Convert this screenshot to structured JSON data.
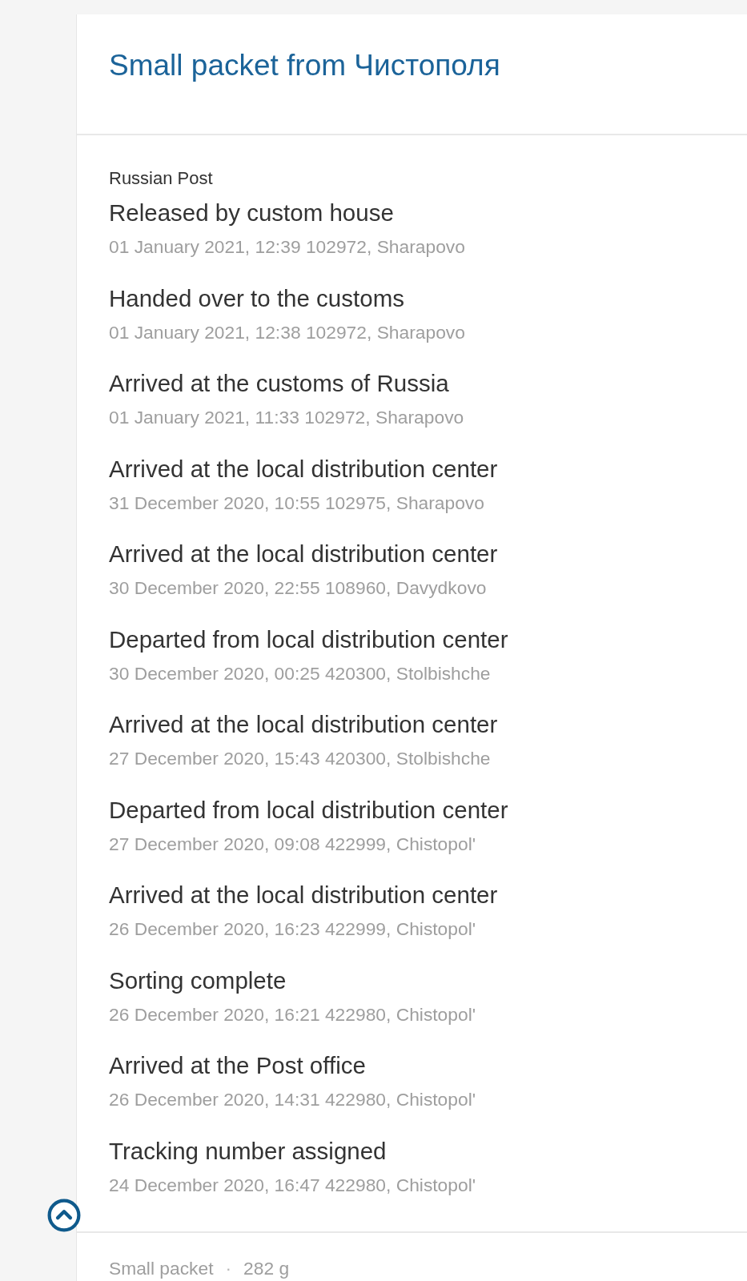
{
  "header": {
    "title": "Small packet from Чистополя"
  },
  "tracking": {
    "carrier": "Russian Post",
    "events": [
      {
        "status": "Released by custom house",
        "details": "01 January 2021, 12:39 102972, Sharapovo"
      },
      {
        "status": "Handed over to the customs",
        "details": "01 January 2021, 12:38 102972, Sharapovo"
      },
      {
        "status": "Arrived at the customs of Russia",
        "details": "01 January 2021, 11:33 102972, Sharapovo"
      },
      {
        "status": "Arrived at the local distribution center",
        "details": "31 December 2020, 10:55 102975, Sharapovo"
      },
      {
        "status": "Arrived at the local distribution center",
        "details": "30 December 2020, 22:55 108960, Davydkovo"
      },
      {
        "status": "Departed from local distribution center",
        "details": "30 December 2020, 00:25 420300, Stolbishche"
      },
      {
        "status": "Arrived at the local distribution center",
        "details": "27 December 2020, 15:43 420300, Stolbishche"
      },
      {
        "status": "Departed from local distribution center",
        "details": "27 December 2020, 09:08 422999, Chistopol'"
      },
      {
        "status": "Arrived at the local distribution center",
        "details": "26 December 2020, 16:23 422999, Chistopol'"
      },
      {
        "status": "Sorting complete",
        "details": "26 December 2020, 16:21 422980, Chistopol'"
      },
      {
        "status": "Arrived at the Post office",
        "details": "26 December 2020, 14:31 422980, Chistopol'"
      },
      {
        "status": "Tracking number assigned",
        "details": "24 December 2020, 16:47 422980, Chistopol'"
      }
    ]
  },
  "footer": {
    "parcel_type": "Small packet",
    "separator": "·",
    "weight": "282 g"
  }
}
